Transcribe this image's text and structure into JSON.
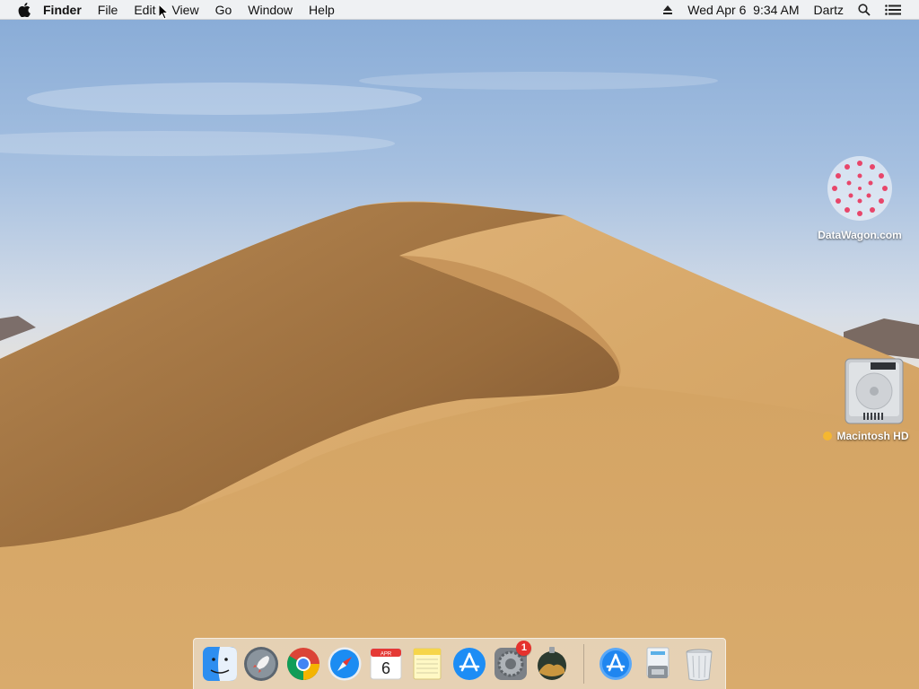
{
  "menubar": {
    "apple_icon": "apple-icon",
    "app_name": "Finder",
    "menus": [
      "File",
      "Edit",
      "View",
      "Go",
      "Window",
      "Help"
    ],
    "status": {
      "eject_icon": "eject-icon",
      "datetime": "Wed Apr 6  9:34 AM",
      "user": "Dartz",
      "search_icon": "spotlight-icon",
      "notification_icon": "notification-center-icon"
    }
  },
  "desktop_icons": [
    {
      "label": "DataWagon.com",
      "icon": "datawagon-logo-icon"
    },
    {
      "label": "Macintosh HD",
      "icon": "hard-drive-icon",
      "tag_color": "#f5b731"
    }
  ],
  "dock": {
    "apps": [
      {
        "name": "Finder",
        "icon": "finder-icon"
      },
      {
        "name": "Launchpad",
        "icon": "launchpad-icon"
      },
      {
        "name": "Google Chrome",
        "icon": "chrome-icon"
      },
      {
        "name": "Safari",
        "icon": "safari-icon"
      },
      {
        "name": "Calendar",
        "icon": "calendar-icon",
        "month": "APR",
        "day": "6"
      },
      {
        "name": "Notes",
        "icon": "notes-icon"
      },
      {
        "name": "App Store",
        "icon": "app-store-icon"
      },
      {
        "name": "System Preferences",
        "icon": "system-preferences-icon",
        "badge": "1"
      },
      {
        "name": "macOS Installer",
        "icon": "macos-installer-icon"
      }
    ],
    "others": [
      {
        "name": "Applications",
        "icon": "applications-folder-icon"
      },
      {
        "name": "Downloads",
        "icon": "downloads-stack-icon"
      },
      {
        "name": "Trash",
        "icon": "trash-icon"
      }
    ]
  },
  "colors": {
    "menubar_bg": "#f4f4f4",
    "badge_red": "#e5322d",
    "dune_sand": "#d3a567"
  }
}
